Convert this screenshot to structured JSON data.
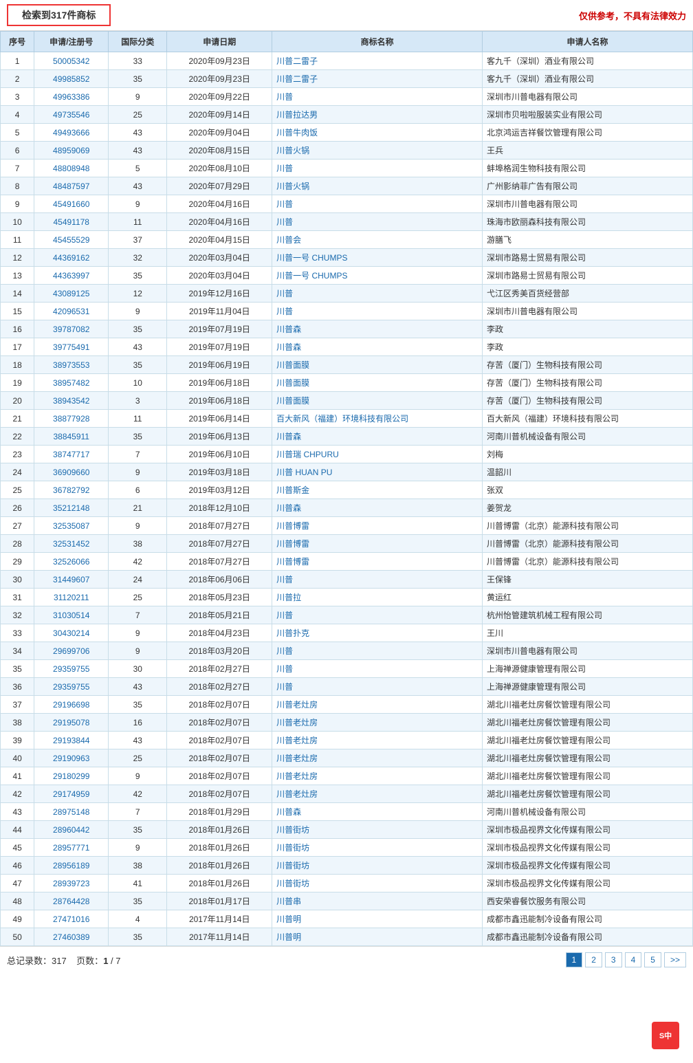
{
  "topBar": {
    "searchResult": "检索到317件商标",
    "disclaimer": "仅供参考，不具有法律效力"
  },
  "table": {
    "headers": [
      "序号",
      "申请/注册号",
      "国际分类",
      "申请日期",
      "商标名称",
      "申请人名称"
    ],
    "rows": [
      [
        "1",
        "50005342",
        "33",
        "2020年09月23日",
        "川普二雷子",
        "客九千（深圳）酒业有限公司"
      ],
      [
        "2",
        "49985852",
        "35",
        "2020年09月23日",
        "川普二雷子",
        "客九千（深圳）酒业有限公司"
      ],
      [
        "3",
        "49963386",
        "9",
        "2020年09月22日",
        "川普",
        "深圳市川普电器有限公司"
      ],
      [
        "4",
        "49735546",
        "25",
        "2020年09月14日",
        "川普拉达男",
        "深圳市贝啦啦服装实业有限公司"
      ],
      [
        "5",
        "49493666",
        "43",
        "2020年09月04日",
        "川普牛肉饭",
        "北京鸿运吉祥餐饮管理有限公司"
      ],
      [
        "6",
        "48959069",
        "43",
        "2020年08月15日",
        "川普火锅",
        "王兵"
      ],
      [
        "7",
        "48808948",
        "5",
        "2020年08月10日",
        "川普",
        "蚌埠格润生物科技有限公司"
      ],
      [
        "8",
        "48487597",
        "43",
        "2020年07月29日",
        "川普火锅",
        "广州影纳菲广告有限公司"
      ],
      [
        "9",
        "45491660",
        "9",
        "2020年04月16日",
        "川普",
        "深圳市川普电器有限公司"
      ],
      [
        "10",
        "45491178",
        "11",
        "2020年04月16日",
        "川普",
        "珠海市欧丽森科技有限公司"
      ],
      [
        "11",
        "45455529",
        "37",
        "2020年04月15日",
        "川普会",
        "游膳飞"
      ],
      [
        "12",
        "44369162",
        "32",
        "2020年03月04日",
        "川普一号 CHUMPS",
        "深圳市路易士贸易有限公司"
      ],
      [
        "13",
        "44363997",
        "35",
        "2020年03月04日",
        "川普一号 CHUMPS",
        "深圳市路易士贸易有限公司"
      ],
      [
        "14",
        "43089125",
        "12",
        "2019年12月16日",
        "川普",
        "弋江区秀美百货经营部"
      ],
      [
        "15",
        "42096531",
        "9",
        "2019年11月04日",
        "川普",
        "深圳市川普电器有限公司"
      ],
      [
        "16",
        "39787082",
        "35",
        "2019年07月19日",
        "川普森",
        "李政"
      ],
      [
        "17",
        "39775491",
        "43",
        "2019年07月19日",
        "川普森",
        "李政"
      ],
      [
        "18",
        "38973553",
        "35",
        "2019年06月19日",
        "川普面膜",
        "存苦（厦门）生物科技有限公司"
      ],
      [
        "19",
        "38957482",
        "10",
        "2019年06月18日",
        "川普面膜",
        "存苦（厦门）生物科技有限公司"
      ],
      [
        "20",
        "38943542",
        "3",
        "2019年06月18日",
        "川普面膜",
        "存苦（厦门）生物科技有限公司"
      ],
      [
        "21",
        "38877928",
        "11",
        "2019年06月14日",
        "百大新风（福建）环境科技有限公司",
        "百大新风（福建）环境科技有限公司"
      ],
      [
        "22",
        "38845911",
        "35",
        "2019年06月13日",
        "川普森",
        "河南川普机械设备有限公司"
      ],
      [
        "23",
        "38747717",
        "7",
        "2019年06月10日",
        "川普瑞 CHPURU",
        "刘梅"
      ],
      [
        "24",
        "36909660",
        "9",
        "2019年03月18日",
        "川普 HUAN PU",
        "温韶川"
      ],
      [
        "25",
        "36782792",
        "6",
        "2019年03月12日",
        "川普斯金",
        "张双"
      ],
      [
        "26",
        "35212148",
        "21",
        "2018年12月10日",
        "川普森",
        "姜贺龙"
      ],
      [
        "27",
        "32535087",
        "9",
        "2018年07月27日",
        "川普博雷",
        "川普博雷（北京）能源科技有限公司"
      ],
      [
        "28",
        "32531452",
        "38",
        "2018年07月27日",
        "川普博雷",
        "川普博雷（北京）能源科技有限公司"
      ],
      [
        "29",
        "32526066",
        "42",
        "2018年07月27日",
        "川普博雷",
        "川普博雷（北京）能源科技有限公司"
      ],
      [
        "30",
        "31449607",
        "24",
        "2018年06月06日",
        "川普",
        "王保锋"
      ],
      [
        "31",
        "31120211",
        "25",
        "2018年05月23日",
        "川普拉",
        "黄运红"
      ],
      [
        "32",
        "31030514",
        "7",
        "2018年05月21日",
        "川普",
        "杭州怡管建筑机械工程有限公司"
      ],
      [
        "33",
        "30430214",
        "9",
        "2018年04月23日",
        "川普扑克",
        "王川"
      ],
      [
        "34",
        "29699706",
        "9",
        "2018年03月20日",
        "川普",
        "深圳市川普电器有限公司"
      ],
      [
        "35",
        "29359755",
        "30",
        "2018年02月27日",
        "川普",
        "上海禅源健康管理有限公司"
      ],
      [
        "36",
        "29359755",
        "43",
        "2018年02月27日",
        "川普",
        "上海禅源健康管理有限公司"
      ],
      [
        "37",
        "29196698",
        "35",
        "2018年02月07日",
        "川普老灶房",
        "湖北川福老灶房餐饮管理有限公司"
      ],
      [
        "38",
        "29195078",
        "16",
        "2018年02月07日",
        "川普老灶房",
        "湖北川福老灶房餐饮管理有限公司"
      ],
      [
        "39",
        "29193844",
        "43",
        "2018年02月07日",
        "川普老灶房",
        "湖北川福老灶房餐饮管理有限公司"
      ],
      [
        "40",
        "29190963",
        "25",
        "2018年02月07日",
        "川普老灶房",
        "湖北川福老灶房餐饮管理有限公司"
      ],
      [
        "41",
        "29180299",
        "9",
        "2018年02月07日",
        "川普老灶房",
        "湖北川福老灶房餐饮管理有限公司"
      ],
      [
        "42",
        "29174959",
        "42",
        "2018年02月07日",
        "川普老灶房",
        "湖北川福老灶房餐饮管理有限公司"
      ],
      [
        "43",
        "28975148",
        "7",
        "2018年01月29日",
        "川普森",
        "河南川普机械设备有限公司"
      ],
      [
        "44",
        "28960442",
        "35",
        "2018年01月26日",
        "川普街坊",
        "深圳市极品视界文化传媒有限公司"
      ],
      [
        "45",
        "28957771",
        "9",
        "2018年01月26日",
        "川普街坊",
        "深圳市极品视界文化传媒有限公司"
      ],
      [
        "46",
        "28956189",
        "38",
        "2018年01月26日",
        "川普街坊",
        "深圳市极品视界文化传媒有限公司"
      ],
      [
        "47",
        "28939723",
        "41",
        "2018年01月26日",
        "川普街坊",
        "深圳市极品视界文化传媒有限公司"
      ],
      [
        "48",
        "28764428",
        "35",
        "2018年01月17日",
        "川普串",
        "西安荣睿餐饮服务有限公司"
      ],
      [
        "49",
        "27471016",
        "4",
        "2017年11月14日",
        "川普明",
        "成都市鑫迅能制冷设备有限公司"
      ],
      [
        "50",
        "27460389",
        "35",
        "2017年11月14日",
        "川普明",
        "成都市鑫迅能制冷设备有限公司"
      ]
    ]
  },
  "bottomBar": {
    "totalLabel": "总记录数：",
    "totalCount": "317",
    "pageLabel": "页数：",
    "currentPage": "1",
    "totalPages": "7"
  },
  "pagination": {
    "buttons": [
      "1",
      "2",
      "3",
      "4",
      "5",
      ">>"
    ]
  },
  "watermark": "S中"
}
